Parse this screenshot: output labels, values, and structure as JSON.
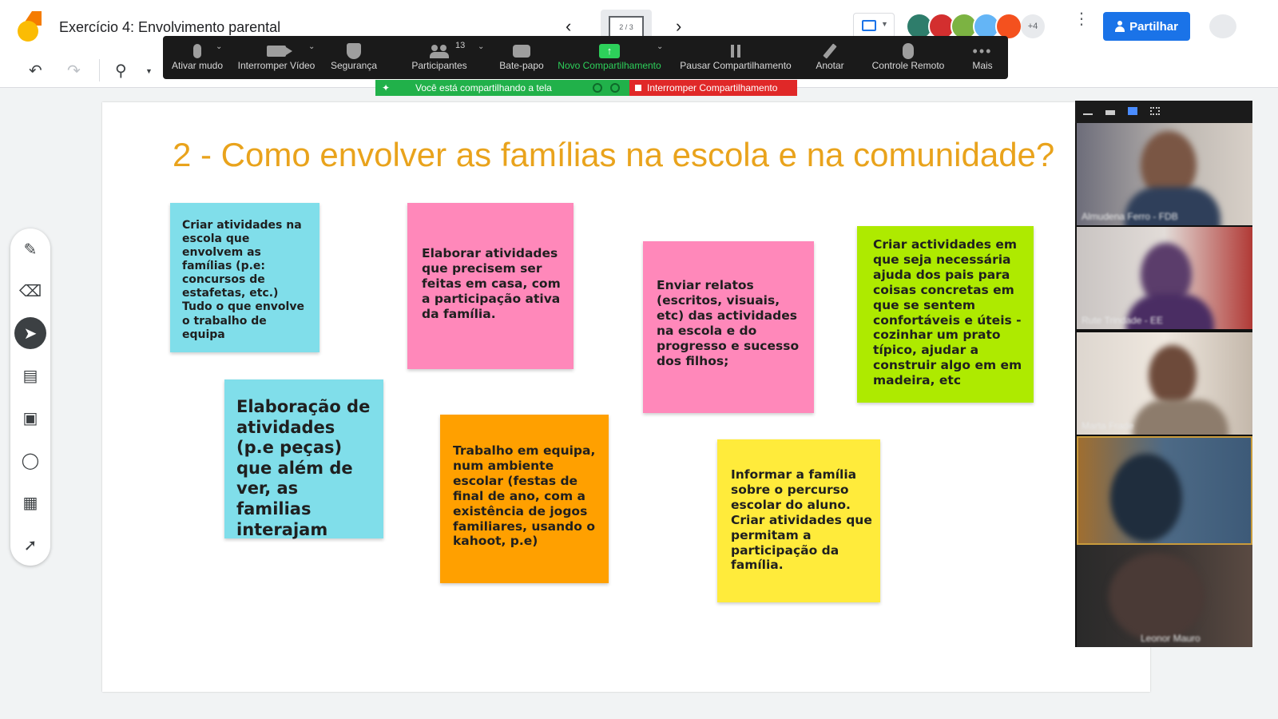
{
  "app": {
    "title": "Exercício 4: Envolvimento parental",
    "page_indicator": "2 / 3",
    "more_participants": "+4",
    "share_label": "Partilhar"
  },
  "zoom": {
    "items": [
      {
        "label": "Ativar mudo",
        "icon": "microphone-icon"
      },
      {
        "label": "Interromper Vídeo",
        "icon": "video-camera-icon"
      },
      {
        "label": "Segurança",
        "icon": "shield-icon"
      },
      {
        "label": "Participantes",
        "icon": "participants-icon",
        "count": "13"
      },
      {
        "label": "Bate-papo",
        "icon": "chat-icon"
      },
      {
        "label": "Novo Compartilhamento",
        "icon": "new-share-icon"
      },
      {
        "label": "Pausar Compartilhamento",
        "icon": "pause-icon"
      },
      {
        "label": "Anotar",
        "icon": "pencil-icon"
      },
      {
        "label": "Controle Remoto",
        "icon": "mouse-icon"
      },
      {
        "label": "Mais",
        "icon": "more-icon"
      }
    ],
    "sharing_status": "Você está compartilhando a tela",
    "stop_sharing": "Interromper Compartilhamento"
  },
  "board": {
    "heading": "2 - Como envolver as famílias na escola e na comunidade?",
    "notes": [
      {
        "text": "Criar atividades na escola que envolvem as famílias (p.e: concursos de estafetas, etc.) Tudo o que envolve o trabalho de equipa",
        "color": "#80deea"
      },
      {
        "text": "Elaborar atividades que precisem ser feitas em casa, com a participação ativa da família.",
        "color": "#ff88ba"
      },
      {
        "text": "Enviar relatos (escritos, visuais, etc) das actividades na escola e do progresso e sucesso dos filhos;",
        "color": "#ff88ba"
      },
      {
        "text": "Criar actividades em que seja necessária ajuda dos pais para coisas concretas em que se sentem confortáveis e úteis - cozinhar um prato típico, ajudar a construir algo em em madeira, etc",
        "color": "#aeea00"
      },
      {
        "text": "Elaboração de atividades (p.e peças) que além de ver, as familias interajam",
        "color": "#80deea"
      },
      {
        "text": "Trabalho em equipa, num ambiente escolar (festas de final de ano, com a existência de jogos familiares, usando o kahoot, p.e)",
        "color": "#ffa000"
      },
      {
        "text": "Informar a família sobre o percurso escolar do aluno. Criar atividades que permitam a participação da família.",
        "color": "#ffeb3b"
      }
    ]
  },
  "videos": [
    {
      "name": "Almudena Ferro - FDB"
    },
    {
      "name": "Rute Trindade - EE"
    },
    {
      "name": "Marta Frade"
    },
    {
      "name": ""
    },
    {
      "name": "Leonor Mauro"
    }
  ],
  "colors": {
    "accent": "#1a73e8",
    "heading": "#e9a31c",
    "zoom_green": "#21b14a",
    "zoom_red": "#e02828"
  }
}
